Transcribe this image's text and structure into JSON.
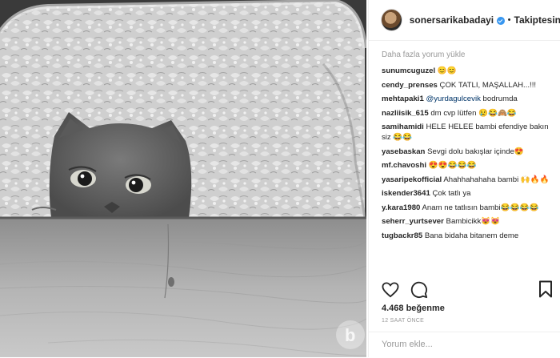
{
  "post": {
    "image_alt": "Grey Scottish Fold cat peeking over a wooden table in front of a fluffy white blanket",
    "watermark": "b"
  },
  "header": {
    "username": "sonersarikabadayi",
    "separator": "•",
    "follow_label": "Takiptesin"
  },
  "comments": {
    "load_more": "Daha fazla yorum yükle",
    "items": [
      {
        "user": "sunumcuguzel",
        "pre": "",
        "mention": "",
        "text": "😊😊"
      },
      {
        "user": "cendy_prenses",
        "pre": "",
        "mention": "",
        "text": "ÇOK TATLI, MAŞALLAH...!!!"
      },
      {
        "user": "mehtapaki1",
        "pre": "",
        "mention": "@yurdagulcevik",
        "text": " bodrumda"
      },
      {
        "user": "nazliisik_615",
        "pre": "",
        "mention": "",
        "text": "dm cvp lütfen 😢😂🙈😂"
      },
      {
        "user": "samihamidi",
        "pre": "",
        "mention": "",
        "text": "HELE HELEE bambi efendiye bakın siz 😂😂"
      },
      {
        "user": "yasebaskan",
        "pre": "",
        "mention": "",
        "text": "Sevgi dolu bakışlar içinde😍"
      },
      {
        "user": "mf.chavoshi",
        "pre": "",
        "mention": "",
        "text": "😍😍😂😂😂"
      },
      {
        "user": "yasaripekofficial",
        "pre": "",
        "mention": "",
        "text": "Ahahhahahaha bambi 🙌🔥🔥"
      },
      {
        "user": "iskender3641",
        "pre": "",
        "mention": "",
        "text": "Çok tatlı ya"
      },
      {
        "user": "y.kara1980",
        "pre": "",
        "mention": "",
        "text": "Anam ne tatlısın bambi😂😂😂😂"
      },
      {
        "user": "seherr_yurtsever",
        "pre": "",
        "mention": "",
        "text": "Bambicikk😻😻"
      },
      {
        "user": "tugbackr85",
        "pre": "",
        "mention": "",
        "text": "Bana bidaha bitanem deme"
      }
    ]
  },
  "actions": {
    "like_icon": "heart-outline-icon",
    "comment_icon": "comment-bubble-icon",
    "save_icon": "bookmark-icon"
  },
  "likes_label": "4.468 beğenme",
  "time_label": "12 SAAT ÖNCE",
  "add_comment": {
    "placeholder": "Yorum ekle..."
  },
  "colors": {
    "accent": "#3897f0",
    "divider": "#efefef",
    "muted": "#999999",
    "text": "#262626"
  }
}
